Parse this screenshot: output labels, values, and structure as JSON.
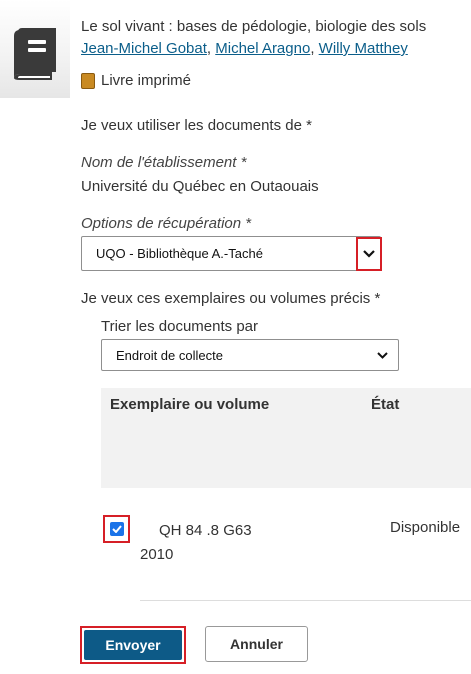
{
  "record": {
    "title": "Le sol vivant : bases de pédologie, biologie des sols",
    "authors": [
      "Jean-Michel Gobat",
      "Michel Aragno",
      "Willy Matthey"
    ],
    "format": "Livre imprimé"
  },
  "form": {
    "use_documents_label": "Je veux utiliser les documents de *",
    "institution_label": "Nom de l'établissement *",
    "institution_value": "Université du Québec en Outaouais",
    "retrieval_label": "Options de récupération *",
    "retrieval_value": "UQO - Bibliothèque A.-Taché",
    "copies_label": "Je veux ces exemplaires ou volumes précis *",
    "sort_label": "Trier les documents par",
    "sort_value": "Endroit de collecte"
  },
  "table": {
    "headers": [
      "Exemplaire ou volume",
      "État"
    ],
    "rows": [
      {
        "call_number": "QH 84 .8 G63",
        "year": "2010",
        "status": "Disponible",
        "checked": true
      }
    ]
  },
  "buttons": {
    "submit": "Envoyer",
    "cancel": "Annuler"
  },
  "colors": {
    "link": "#0b5e8a",
    "primary": "#0d5a87",
    "highlight": "#d61f26",
    "checkbox": "#1a73e8"
  }
}
